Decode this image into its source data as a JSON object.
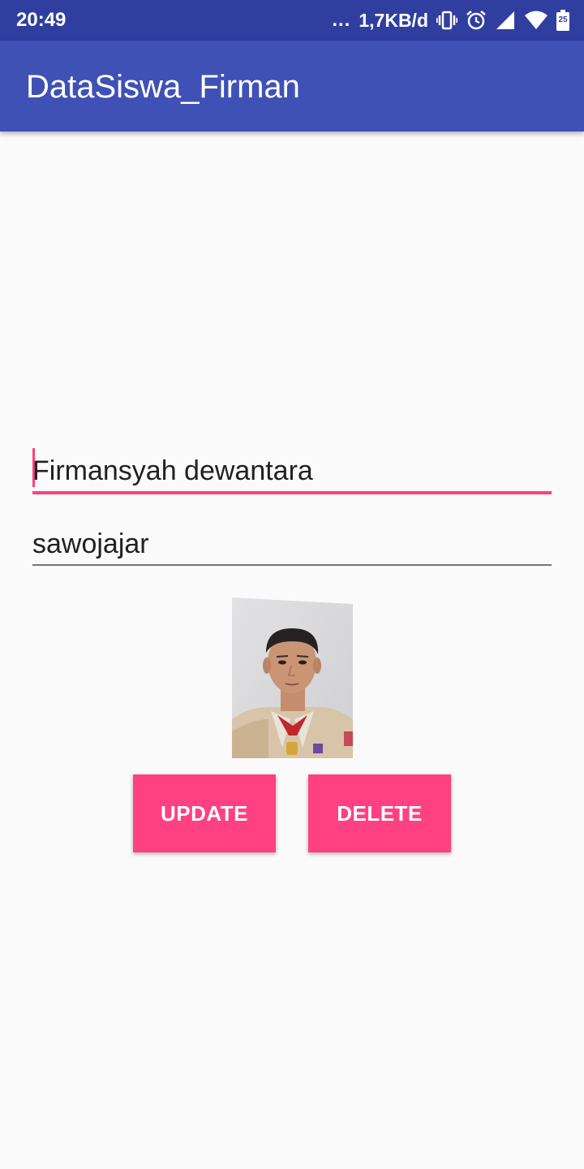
{
  "status_bar": {
    "time": "20:49",
    "dots": "...",
    "speed": "1,7KB/d",
    "icons": [
      "vibrate-icon",
      "alarm-icon",
      "signal-icon",
      "wifi-icon",
      "battery-icon"
    ],
    "battery": "25"
  },
  "app_bar": {
    "title": "DataSiswa_Firman"
  },
  "form": {
    "name_value": "Firmansyah dewantara",
    "address_value": "sawojajar"
  },
  "photo": {
    "icon": "student-photo"
  },
  "buttons": {
    "update_label": "UPDATE",
    "delete_label": "DELETE"
  },
  "colors": {
    "status_bar": "#303f9f",
    "app_bar": "#3f51b5",
    "accent": "#ff4081",
    "background": "#fafafa"
  }
}
